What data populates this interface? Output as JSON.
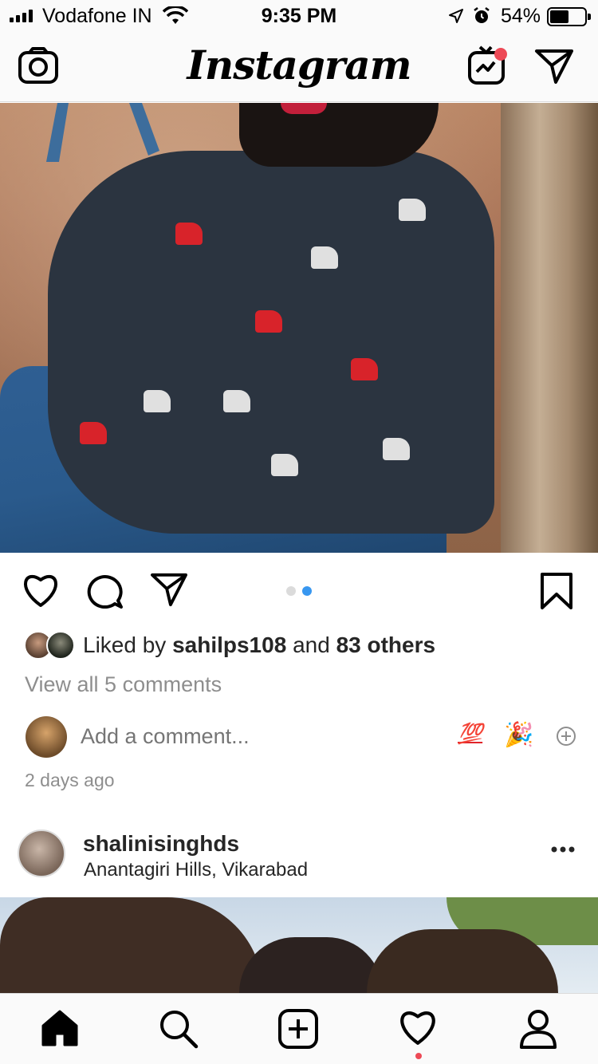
{
  "status_bar": {
    "carrier": "Vodafone IN",
    "time": "9:35 PM",
    "battery": "54%",
    "battery_level": 0.54
  },
  "top_nav": {
    "logo": "Instagram",
    "igtv_has_new": true
  },
  "post": {
    "image_index": 2,
    "image_count": 2,
    "liked_by": "sahilps108",
    "likes_prefix": "Liked by",
    "likes_and": "and",
    "others_count": "83 others",
    "view_comments": "View all 5 comments",
    "comment_placeholder": "Add a comment...",
    "quick_emojis": [
      "💯",
      "🎉"
    ],
    "timestamp": "2 days ago"
  },
  "next_post": {
    "username": "shalinisinghds",
    "location": "Anantagiri Hills, Vikarabad"
  },
  "tab_bar": {
    "items": [
      "home-icon",
      "search-icon",
      "new-post-icon",
      "activity-icon",
      "profile-icon"
    ],
    "active": "home-icon",
    "activity_has_notification": true
  },
  "colors": {
    "accent": "#3897f0",
    "notification": "#ed4956",
    "muted_text": "#8e8e8e",
    "text": "#262626"
  }
}
